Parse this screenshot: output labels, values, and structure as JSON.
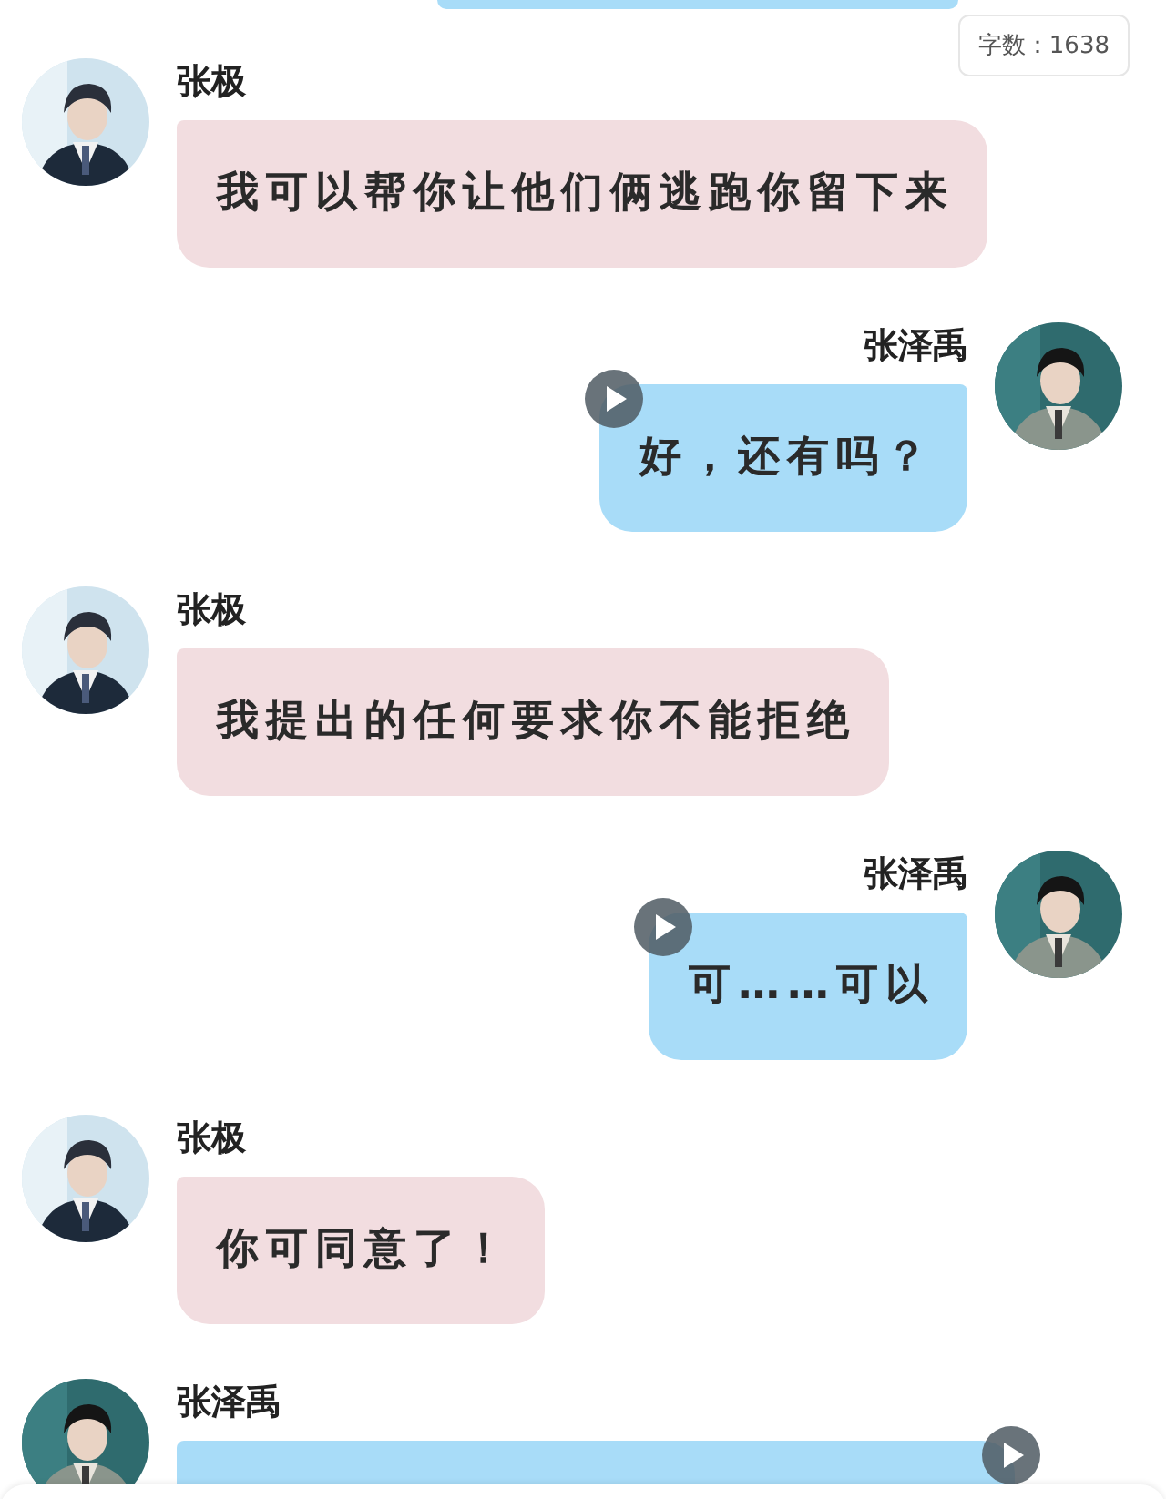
{
  "word_count": "字数：1638",
  "messages": [
    {
      "kind": "incoming",
      "name": "张极",
      "text": "我可以帮你让他们俩逃跑你留下来",
      "color": "#f2dde0",
      "play_button": false
    },
    {
      "kind": "outgoing",
      "name": "张泽禹",
      "text": "好，还有吗？",
      "color": "#a8dcf8",
      "play_button": true
    },
    {
      "kind": "incoming",
      "name": "张极",
      "text": "我提出的任何要求你不能拒绝",
      "color": "#f2dde0",
      "play_button": false
    },
    {
      "kind": "outgoing",
      "name": "张泽禹",
      "text": "可……可以",
      "color": "#a8dcf8",
      "play_button": true
    },
    {
      "kind": "incoming",
      "name": "张极",
      "text": "你可同意了！",
      "color": "#f2dde0",
      "play_button": false
    },
    {
      "kind": "incoming",
      "name": "张泽禹",
      "color": "#a8dcf8",
      "play_button": true
    }
  ]
}
